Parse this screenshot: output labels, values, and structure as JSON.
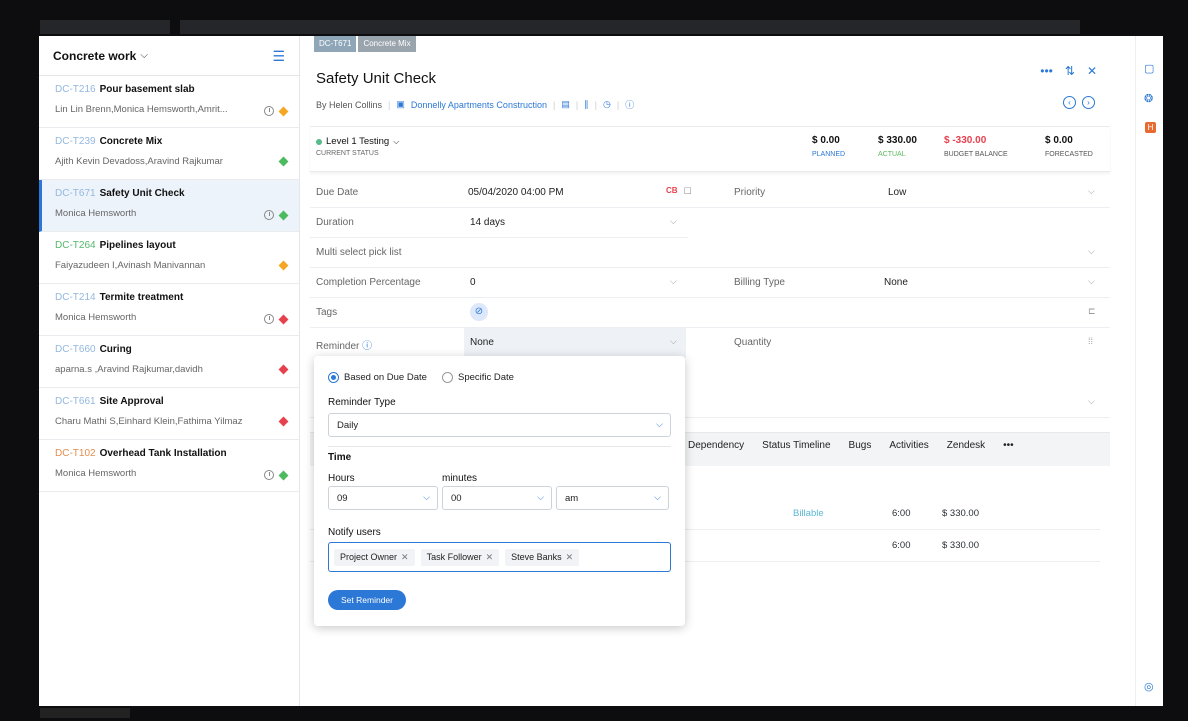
{
  "sidebar": {
    "title": "Concrete work",
    "items": [
      {
        "code": "DC-T216",
        "name": "Pour basement slab",
        "people": "Lin Lin Brenn,Monica Hemsworth,Amrit...",
        "clock": true,
        "status": "#f5a623"
      },
      {
        "code": "DC-T239",
        "name": "Concrete Mix",
        "people": "Ajith Kevin Devadoss,Aravind Rajkumar",
        "clock": false,
        "status": "#4cba5e"
      },
      {
        "code": "DC-T671",
        "name": "Safety Unit Check",
        "people": "Monica Hemsworth",
        "clock": true,
        "status": "#4cba5e",
        "active": true
      },
      {
        "code": "DC-T264",
        "name": "Pipelines layout",
        "people": "Faiyazudeen I,Avinash Manivannan",
        "clock": false,
        "status": "#f5a623"
      },
      {
        "code": "DC-T214",
        "name": "Termite treatment",
        "people": "Monica Hemsworth",
        "clock": true,
        "status": "#e8414e"
      },
      {
        "code": "DC-T660",
        "name": "Curing",
        "people": "aparna.s ,Aravind Rajkumar,davidh",
        "clock": false,
        "status": "#e8414e"
      },
      {
        "code": "DC-T661",
        "name": "Site Approval",
        "people": "Charu Mathi S,Einhard Klein,Fathima Yilmaz",
        "clock": false,
        "status": "#e8414e"
      },
      {
        "code": "DC-T102",
        "name": "Overhead Tank Installation",
        "people": "Monica Hemsworth",
        "clock": true,
        "status": "#4cba5e"
      }
    ]
  },
  "breadcrumb": {
    "code": "DC-T671",
    "parent": "Concrete Mix"
  },
  "task": {
    "title": "Safety Unit Check",
    "by": "By Helen Collins",
    "project": "Donnelly Apartments Construction",
    "status": "Level 1 Testing",
    "status_label": "CURRENT STATUS"
  },
  "budget": [
    {
      "value": "$ 0.00",
      "label": "PLANNED",
      "color": "#2b78d6"
    },
    {
      "value": "$ 330.00",
      "label": "ACTUAL",
      "color": "#5cb85c"
    },
    {
      "value": "$ -330.00",
      "label": "BUDGET BALANCE",
      "color": "#555555",
      "vcolor": "#e8414e"
    },
    {
      "value": "$ 0.00",
      "label": "FORECASTED",
      "color": "#555555"
    }
  ],
  "fields": {
    "due_date_label": "Due Date",
    "due_date": "05/04/2020 04:00 PM",
    "priority_label": "Priority",
    "priority": "Low",
    "duration_label": "Duration",
    "duration": "14  days",
    "multi_label": "Multi select pick list",
    "completion_label": "Completion Percentage",
    "completion": "0",
    "billing_label": "Billing Type",
    "billing": "None",
    "tags_label": "Tags",
    "reminder_label": "Reminder",
    "reminder": "None",
    "quantity_label": "Quantity"
  },
  "tabs": [
    "Dependency",
    "Status Timeline",
    "Bugs",
    "Activities",
    "Zendesk",
    "•••"
  ],
  "billing_rows": [
    {
      "type": "Billable",
      "hours": "6:00",
      "amount": "$ 330.00"
    },
    {
      "type": "",
      "hours": "6:00",
      "amount": "$ 330.00"
    }
  ],
  "reminder_popup": {
    "option_due": "Based on Due Date",
    "option_specific": "Specific Date",
    "type_label": "Reminder Type",
    "type_value": "Daily",
    "time_label": "Time",
    "hours_label": "Hours",
    "minutes_label": "minutes",
    "hours": "09",
    "minutes": "00",
    "ampm": "am",
    "notify_label": "Notify users",
    "chips": [
      "Project Owner",
      "Task Follower",
      "Steve Banks"
    ],
    "button": "Set Reminder"
  }
}
